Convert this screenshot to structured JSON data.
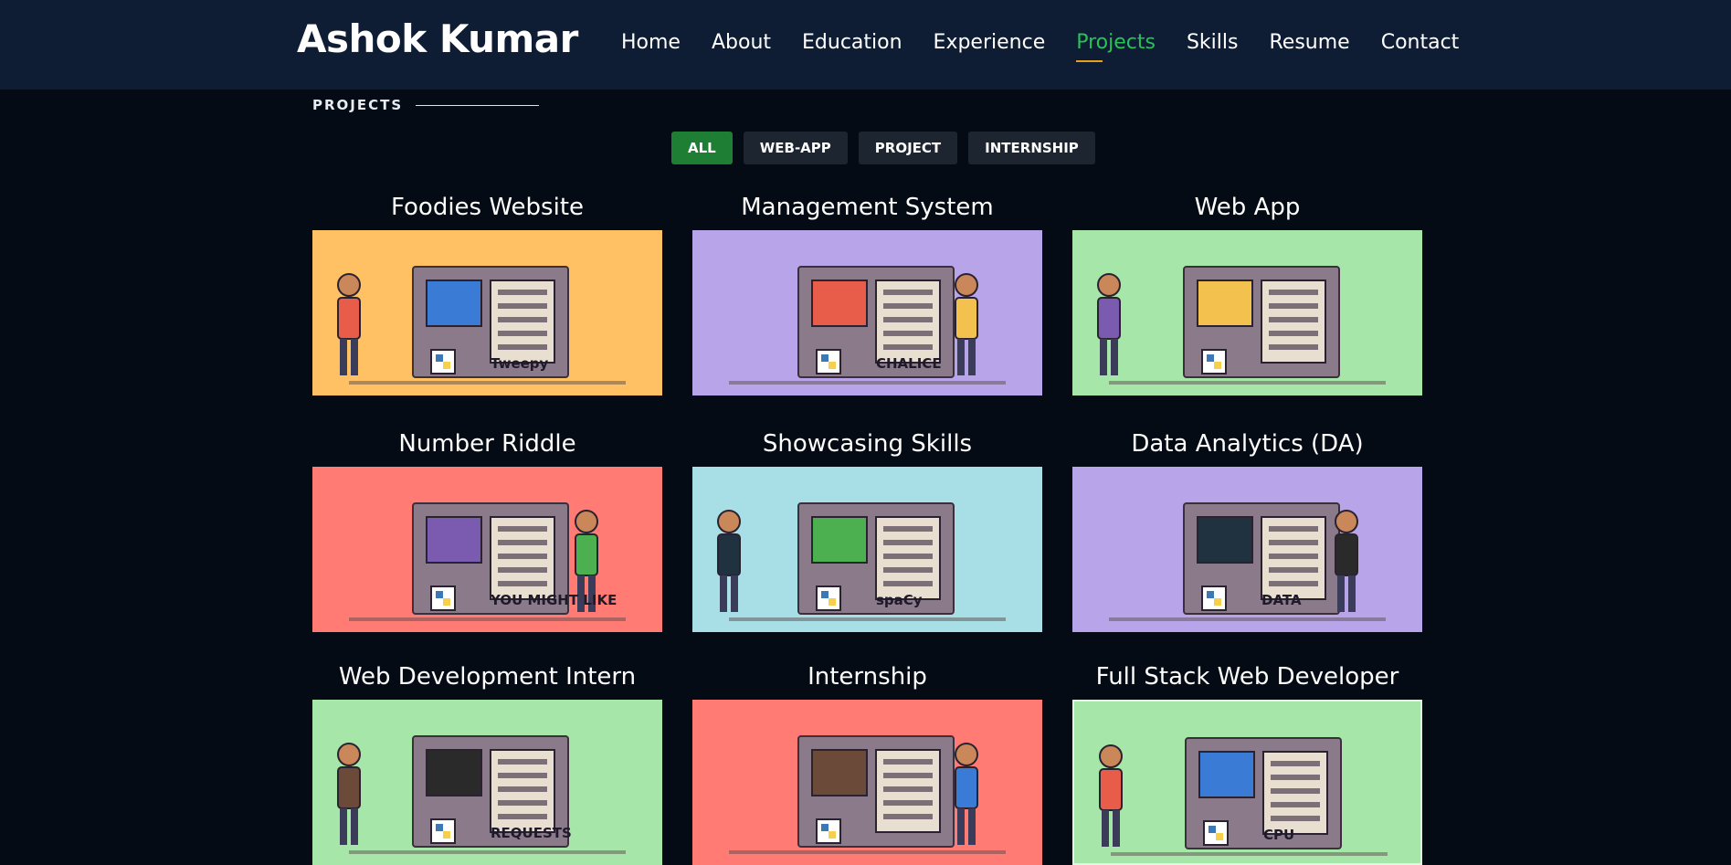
{
  "header": {
    "logo": "Ashok Kumar",
    "nav": [
      "Home",
      "About",
      "Education",
      "Experience",
      "Projects",
      "Skills",
      "Resume",
      "Contact"
    ],
    "active_nav": "Projects"
  },
  "section": {
    "label": "PROJECTS"
  },
  "filters": [
    "ALL",
    "WEB-APP",
    "PROJECT",
    "INTERNSHIP"
  ],
  "active_filter": "ALL",
  "projects": [
    {
      "title": "Foodies Website",
      "bg": "#ffc163",
      "illustration_text": "Tweepy",
      "icon": "bird-robot-illustration"
    },
    {
      "title": "Management System",
      "bg": "#b8a4e8",
      "illustration_text": "CHALICE",
      "icon": "aws-lambda-illustration"
    },
    {
      "title": "Web App",
      "bg": "#a7e6a9",
      "illustration_text": "",
      "icon": "music-speaker-illustration"
    },
    {
      "title": "Number Riddle",
      "bg": "#ff7b74",
      "illustration_text": "YOU MIGHT LIKE",
      "icon": "recommendation-machine-illustration"
    },
    {
      "title": "Showcasing Skills",
      "bg": "#a8dfe6",
      "illustration_text": "spaCy",
      "icon": "nlp-robot-illustration"
    },
    {
      "title": "Data Analytics (DA)",
      "bg": "#b8a4e8",
      "illustration_text": "DATA",
      "icon": "data-pipeline-illustration"
    },
    {
      "title": "Web Development Intern",
      "bg": "#a7e6a9",
      "illustration_text": "REQUESTS",
      "icon": "api-requests-illustration"
    },
    {
      "title": "Internship",
      "bg": "#ff7b74",
      "illustration_text": "",
      "icon": "brain-robot-illustration"
    },
    {
      "title": "Full Stack Web Developer",
      "bg": "#a7e6a9",
      "illustration_text": "CPU",
      "icon": "cpu-machine-illustration"
    }
  ]
}
